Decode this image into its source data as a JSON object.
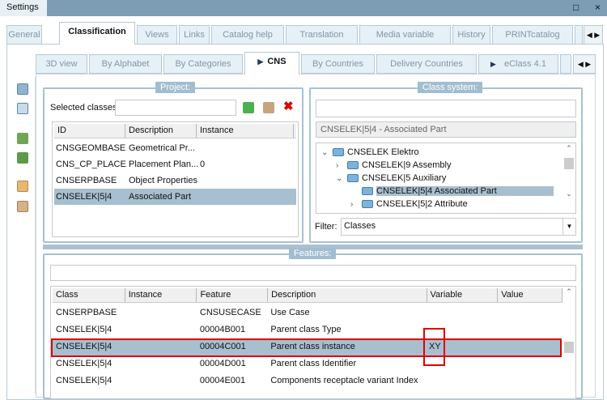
{
  "window": {
    "title": "Settings",
    "maximize_icon": "□",
    "close_icon": "×"
  },
  "main_tabs": [
    "General",
    "Classification",
    "Views",
    "Links",
    "Catalog help",
    "Translation",
    "Media variable",
    "History",
    "PRINTcatalog"
  ],
  "sub_tabs": [
    "3D view",
    "By Alphabet",
    "By Categories",
    "CNS",
    "By Countries",
    "Delivery Countries",
    "eClass 4.1"
  ],
  "project": {
    "legend": "Project:",
    "selected_label": "Selected classes",
    "selected_value": "",
    "columns": [
      "ID",
      "Description",
      "Instance"
    ],
    "rows": [
      [
        "CNSGEOMBASE",
        "Geometrical Pr...",
        ""
      ],
      [
        "CNS_CP_PLACE...",
        "Placement Plan...",
        "0"
      ],
      [
        "CNSERPBASE",
        "Object Properties",
        ""
      ],
      [
        "CNSELEK|5|4",
        "Associated Part",
        ""
      ]
    ],
    "selected_row": 3
  },
  "class_system": {
    "legend": "Class system:",
    "search_value": "",
    "current": "CNSELEK|5|4 - Associated Part",
    "tree": [
      {
        "label": "CNSELEK Elektro",
        "level": 0,
        "state": "open"
      },
      {
        "label": "CNSELEK|9 Assembly",
        "level": 1,
        "state": "closed"
      },
      {
        "label": "CNSELEK|5 Auxiliary",
        "level": 1,
        "state": "open"
      },
      {
        "label": "CNSELEK|5|4 Associated Part",
        "level": 2,
        "state": "leaf",
        "selected": true
      },
      {
        "label": "CNSELEK|5|2 Attribute",
        "level": 2,
        "state": "closed"
      }
    ],
    "filter_label": "Filter:",
    "filter_value": "Classes"
  },
  "features": {
    "legend": "Features:",
    "search_value": "",
    "columns": [
      "Class",
      "Instance",
      "Feature",
      "Description",
      "Variable",
      "Value"
    ],
    "rows": [
      [
        "CNSERPBASE",
        "",
        "CNSUSECASE",
        "Use Case",
        "",
        ""
      ],
      [
        "CNSELEK|5|4",
        "",
        "00004B001",
        "Parent class Type",
        "",
        ""
      ],
      [
        "CNSELEK|5|4",
        "",
        "00004C001",
        "Parent class instance",
        "XY",
        ""
      ],
      [
        "CNSELEK|5|4",
        "",
        "00004D001",
        "Parent class Identifier",
        "",
        ""
      ],
      [
        "CNSELEK|5|4",
        "",
        "00004E001",
        "Components receptacle variant Index",
        "",
        ""
      ]
    ],
    "selected_row": 2
  },
  "colors": {
    "highlight": "#e00000",
    "selection": "#a8bfcf",
    "titlebar": "#7c9db4"
  }
}
